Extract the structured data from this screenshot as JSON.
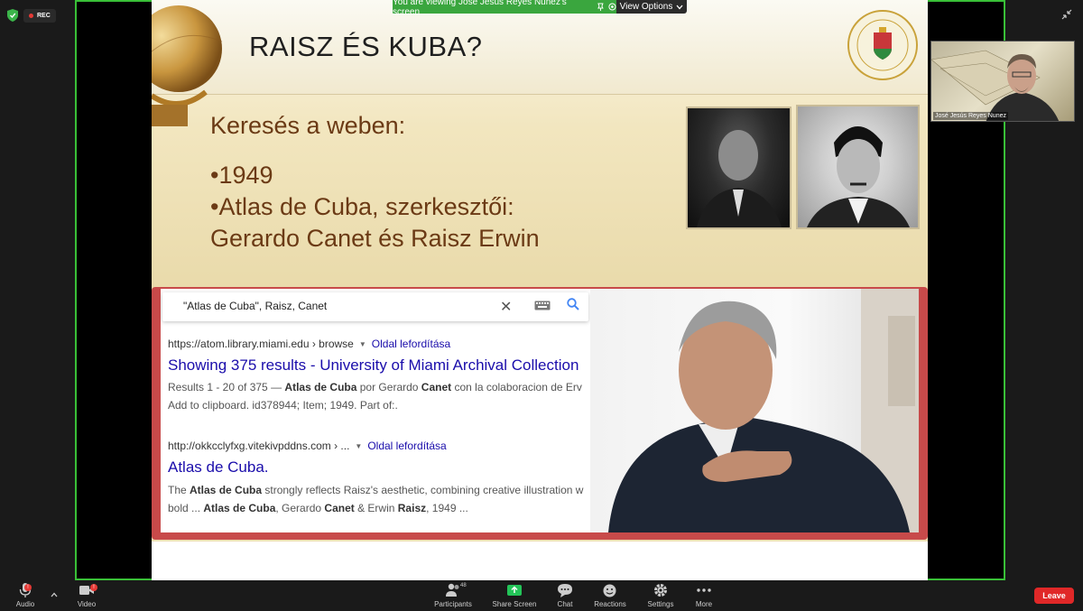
{
  "meeting": {
    "rec_label": "REC",
    "viewing_banner": "You are viewing José Jesús Reyes Nunez's screen",
    "view_options_label": "View Options"
  },
  "slide": {
    "title": "RAISZ ÉS KUBA?",
    "line1": "Keresés a  weben:",
    "line2": "•1949",
    "line3": "•Atlas de Cuba, szerkesztői:",
    "line4": "Gerardo Canet és Raisz Erwin"
  },
  "search": {
    "query": "\"Atlas de Cuba\", Raisz, Canet",
    "results": [
      {
        "url": "https://atom.library.miami.edu › browse",
        "translate": "Oldal lefordítása",
        "title": "Showing 375 results - University of Miami Archival Collection",
        "snippet_pre": "Results 1 - 20 of 375 — ",
        "snippet_b1": "Atlas de Cuba",
        "snippet_mid": " por Gerardo ",
        "snippet_b2": "Canet",
        "snippet_post": " con la colaboracion de Erv",
        "snippet2": "Add to clipboard. id378944; Item; 1949. Part of:."
      },
      {
        "url": "http://okkcclyfxg.vitekivpddns.com › ...",
        "translate": "Oldal lefordítása",
        "title": "Atlas de Cuba.",
        "snippet_pre": "The ",
        "snippet_b1": "Atlas de Cuba",
        "snippet_post": " strongly reflects Raisz's aesthetic, combining creative illustration w",
        "snippet2_pre": "bold ... ",
        "snippet2_b1": "Atlas de Cuba",
        "snippet2_mid": ", Gerardo ",
        "snippet2_b2": "Canet",
        "snippet2_mid2": " & Erwin ",
        "snippet2_b3": "Raisz",
        "snippet2_post": ", 1949 ..."
      }
    ]
  },
  "participant": {
    "name": "José Jesús Reyes Nunez"
  },
  "toolbar": {
    "audio": "Audio",
    "video": "Video",
    "participants": "Participants",
    "participants_count": "48",
    "share_screen": "Share Screen",
    "chat": "Chat",
    "reactions": "Reactions",
    "settings": "Settings",
    "more": "More",
    "leave": "Leave"
  },
  "colors": {
    "accent_green": "#39c037",
    "leave_red": "#e02828",
    "link_blue": "#1a0dab",
    "slide_text": "#6b3a15"
  }
}
